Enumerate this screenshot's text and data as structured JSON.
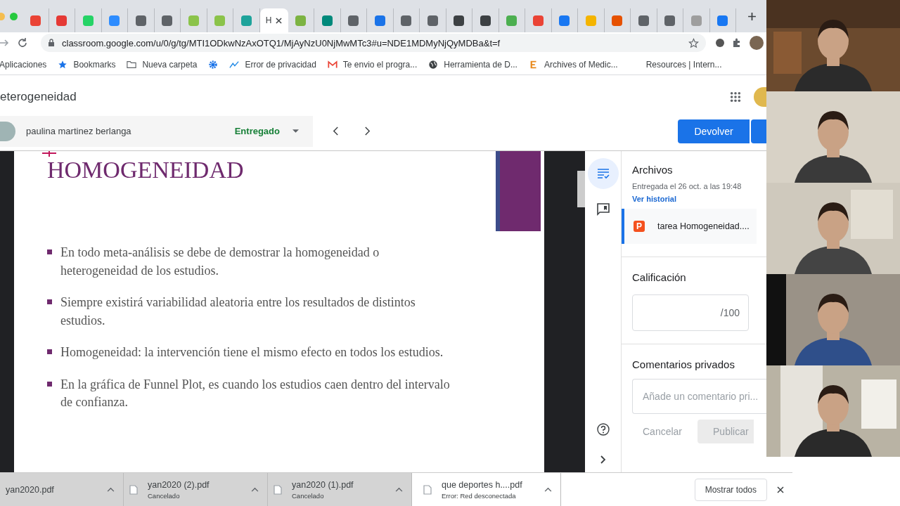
{
  "tabs": [
    {
      "selected": false,
      "color": "#ea4335"
    },
    {
      "selected": false,
      "color": "#e53935"
    },
    {
      "selected": false,
      "color": "#25d366"
    },
    {
      "selected": false,
      "color": "#2d8cff"
    },
    {
      "selected": false,
      "color": "#5f6368"
    },
    {
      "selected": false,
      "color": "#5f6368"
    },
    {
      "selected": false,
      "color": "#8bc34a"
    },
    {
      "selected": false,
      "color": "#8bc34a"
    },
    {
      "selected": false,
      "color": "#1ea39b"
    },
    {
      "label": "H",
      "selected": true
    },
    {
      "selected": false,
      "color": "#7cb342"
    },
    {
      "selected": false,
      "color": "#00897b"
    },
    {
      "selected": false,
      "color": "#5f6368"
    },
    {
      "selected": false,
      "color": "#1a73e8"
    },
    {
      "selected": false,
      "color": "#5f6368"
    },
    {
      "selected": false,
      "color": "#5f6368"
    },
    {
      "selected": false,
      "color": "#3c4043"
    },
    {
      "selected": false,
      "color": "#3c4043"
    },
    {
      "selected": false,
      "color": "#4caf50"
    },
    {
      "selected": false,
      "color": "#ea4335"
    },
    {
      "selected": false,
      "color": "#1877f2"
    },
    {
      "selected": false,
      "color": "#f4b400"
    },
    {
      "selected": false,
      "color": "#e65100"
    },
    {
      "selected": false,
      "color": "#5f6368"
    },
    {
      "selected": false,
      "color": "#5f6368"
    },
    {
      "selected": false,
      "color": "#9e9e9e"
    },
    {
      "selected": false,
      "color": "#1877f2"
    }
  ],
  "address": {
    "url": "classroom.google.com/u/0/g/tg/MTI1ODkwNzAxOTQ1/MjAyNzU0NjMwMTc3#u=NDE1MDMyNjQyMDBa&t=f"
  },
  "bookmarks": [
    {
      "label": "Aplicaciones",
      "kind": "none"
    },
    {
      "label": "Bookmarks",
      "kind": "star"
    },
    {
      "label": "Nueva carpeta",
      "kind": "folder"
    },
    {
      "kind": "gear"
    },
    {
      "label": "Error de privacidad",
      "kind": "chart"
    },
    {
      "label": "Te envio el progra...",
      "kind": "mail"
    },
    {
      "label": "Herramienta de D...",
      "kind": "globe"
    },
    {
      "label": "Archives of Medic...",
      "kind": "letter"
    },
    {
      "label": "Resources | Intern...",
      "kind": "none"
    }
  ],
  "assignment": {
    "title": "eterogeneidad",
    "student": "paulina martinez berlanga",
    "status": "Entregado",
    "return_button": "Devolver"
  },
  "slide": {
    "title": "HOMOGENEIDAD",
    "bullets": [
      "En todo meta-análisis se debe de demostrar la homogeneidad o heterogeneidad de los estudios.",
      "Siempre existirá variabilidad aleatoria entre los resultados de distintos estudios.",
      "Homogeneidad: la intervención tiene el mismo efecto en todos los estudios.",
      "En la gráfica de Funnel Plot, es cuando los estudios caen dentro del intervalo de confianza."
    ]
  },
  "panel": {
    "files_heading": "Archivos",
    "submitted": "Entregada el 26 oct. a las 19:48",
    "history_link": "Ver historial",
    "file": {
      "icon_letter": "P",
      "name": "tarea Homogeneidad...."
    },
    "grade_heading": "Calificación",
    "grade_suffix": "/100",
    "comments_heading": "Comentarios privados",
    "comment_placeholder": "Añade un comentario pri...",
    "cancel": "Cancelar",
    "post": "Publicar"
  },
  "downloads": [
    {
      "name": "yan2020.pdf",
      "icon": false
    },
    {
      "name": "yan2020 (2).pdf",
      "status": "Cancelado",
      "icon": true
    },
    {
      "name": "yan2020 (1).pdf",
      "status": "Cancelado",
      "icon": true
    },
    {
      "name": "que deportes h....pdf",
      "status": "Error: Red desconectada",
      "icon": true
    }
  ],
  "show_all": "Mostrar todos"
}
